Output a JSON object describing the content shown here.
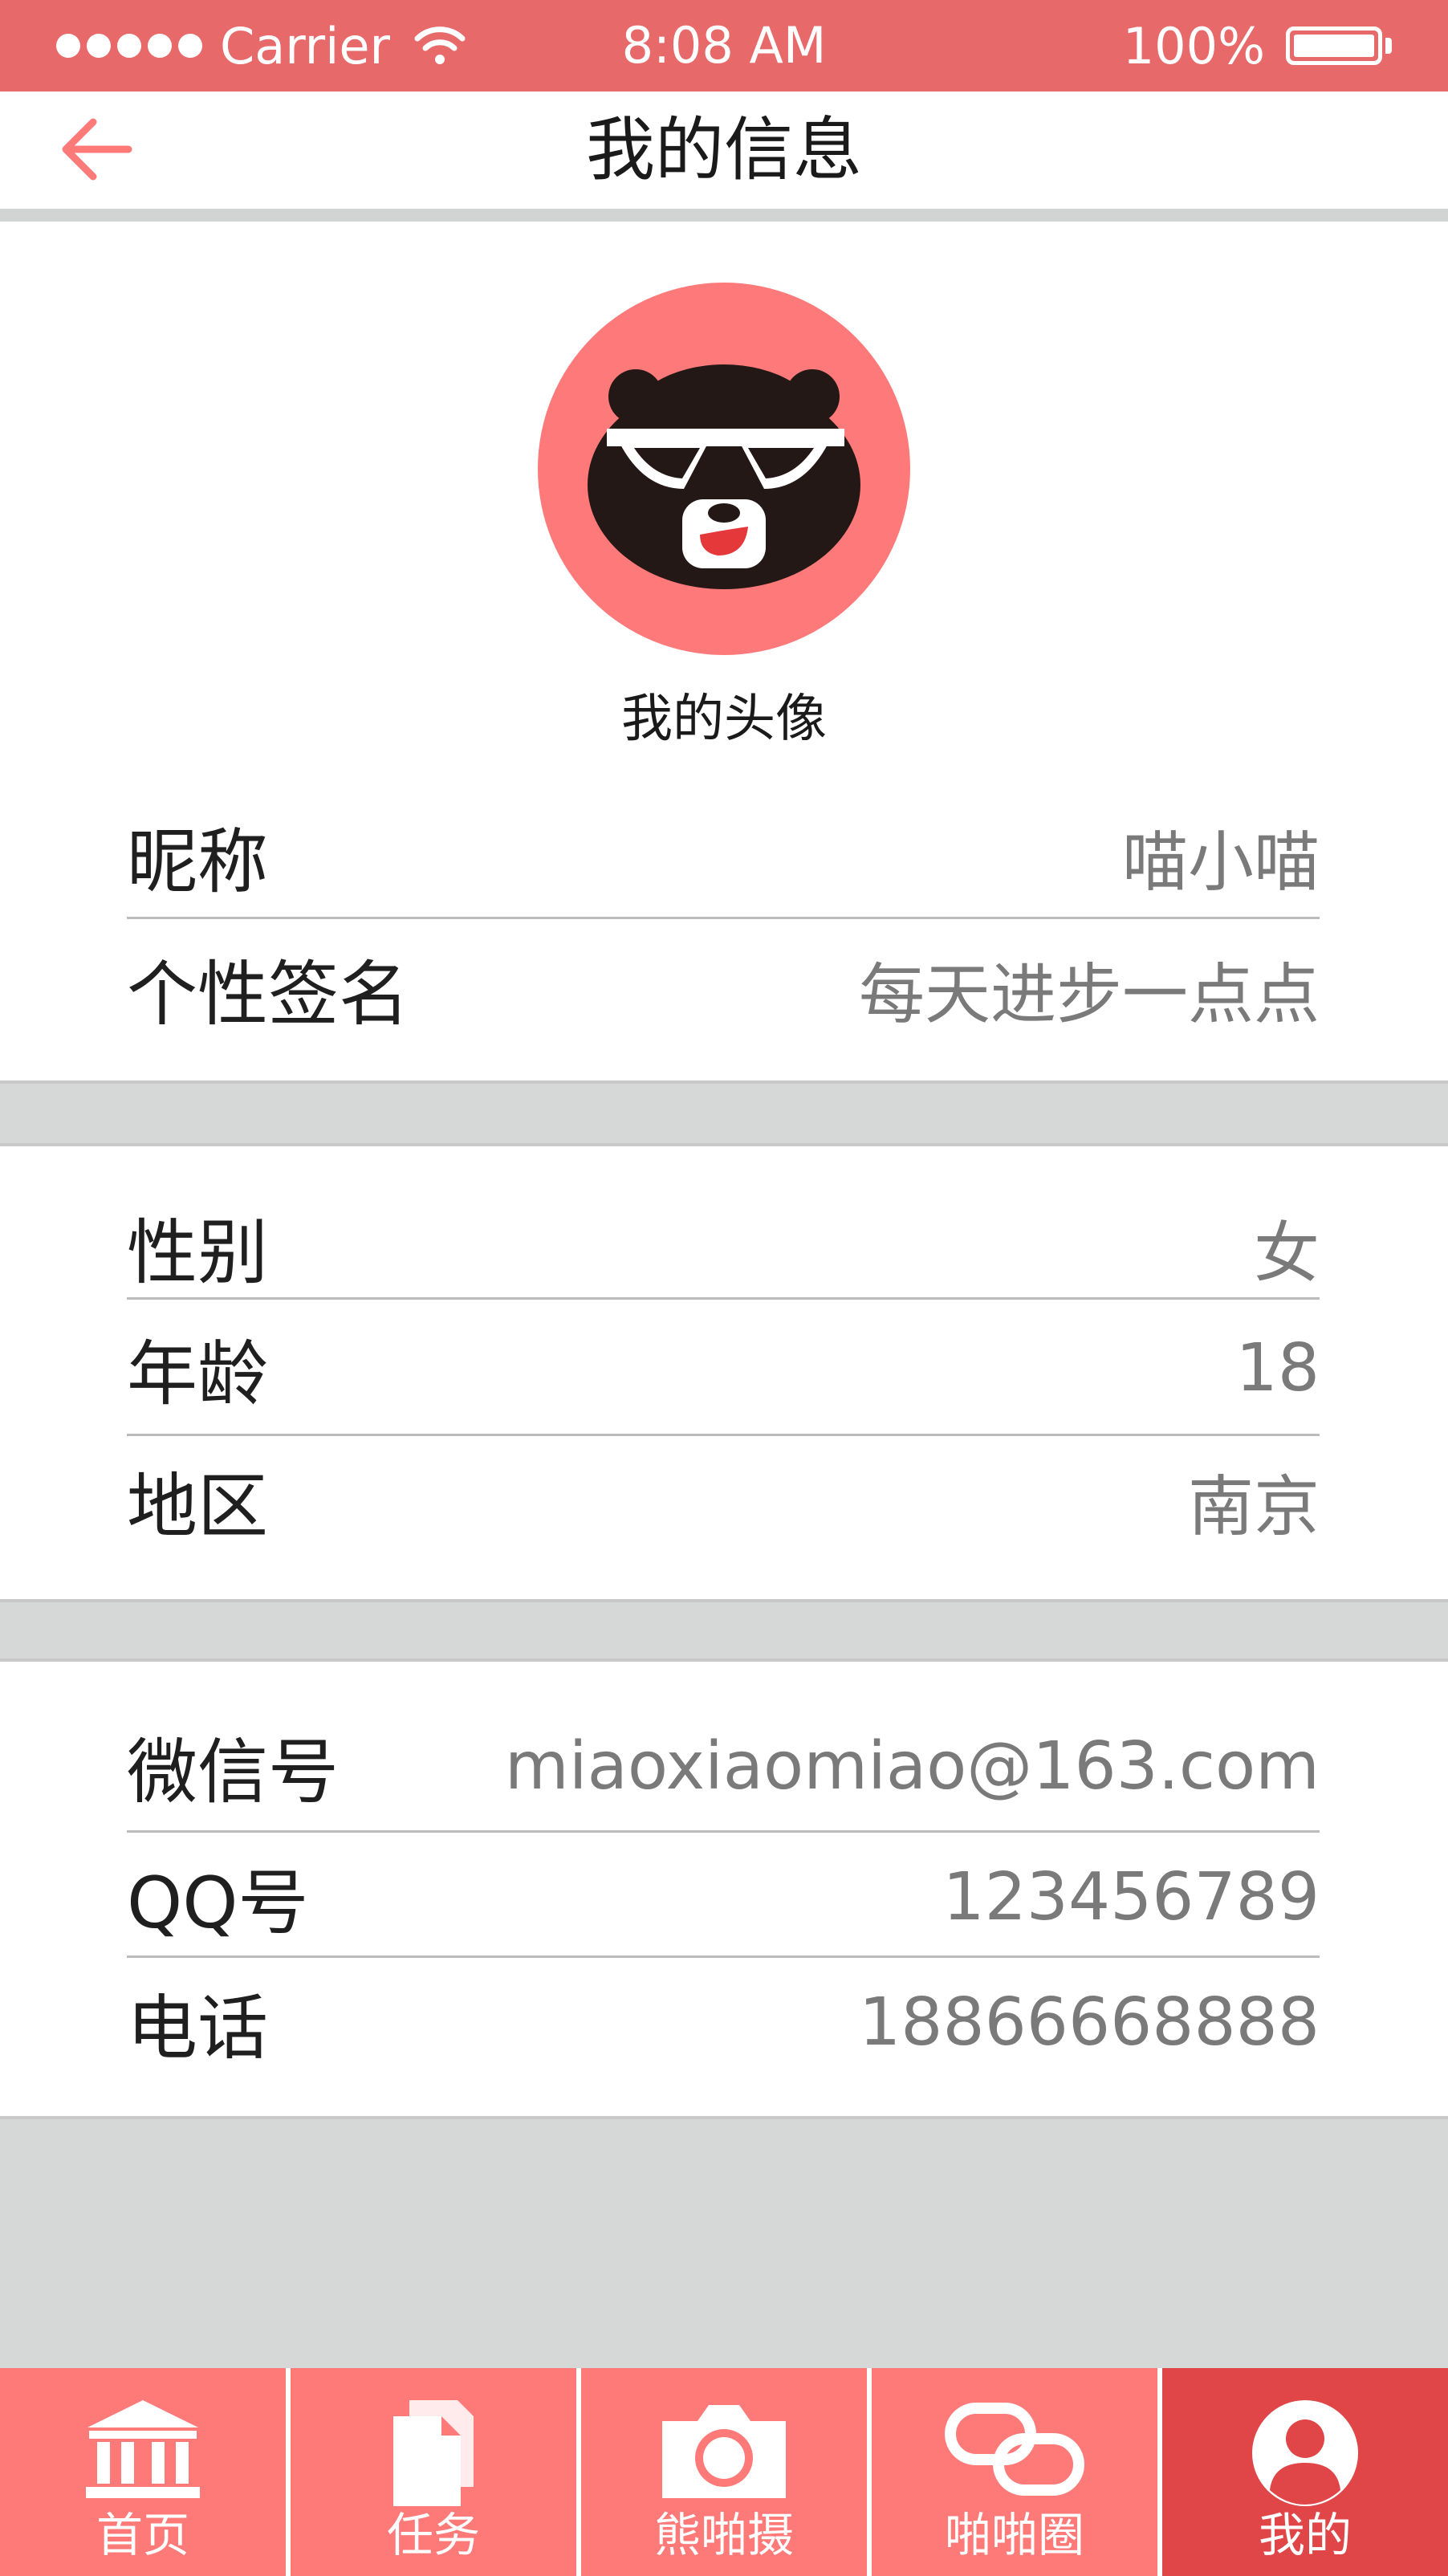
{
  "status_bar": {
    "carrier": "Carrier",
    "time": "8:08 AM",
    "battery": "100%"
  },
  "nav": {
    "title": "我的信息"
  },
  "profile": {
    "avatar_label": "我的头像",
    "avatar_bg": "#fe7a7a"
  },
  "section1": [
    {
      "label": "昵称",
      "value": "喵小喵"
    },
    {
      "label": "个性签名",
      "value": "每天进步一点点"
    }
  ],
  "section2": [
    {
      "label": "性别",
      "value": "女"
    },
    {
      "label": "年龄",
      "value": "18"
    },
    {
      "label": "地区",
      "value": "南京"
    }
  ],
  "section3": [
    {
      "label": "微信号",
      "value": "miaoxiaomiao@163.com"
    },
    {
      "label": "QQ号",
      "value": "123456789"
    },
    {
      "label": "电话",
      "value": "18866668888"
    }
  ],
  "tabs": [
    {
      "label": "首页",
      "icon": "bank-icon"
    },
    {
      "label": "任务",
      "icon": "document-icon"
    },
    {
      "label": "熊啪摄",
      "icon": "camera-icon"
    },
    {
      "label": "啪啪圈",
      "icon": "link-icon"
    },
    {
      "label": "我的",
      "icon": "user-icon",
      "active": true
    }
  ],
  "colors": {
    "status_bar": "#e8696a",
    "tab_bg": "#fd7a79",
    "tab_active": "#e04547",
    "page_bg": "#d6d7d7"
  }
}
